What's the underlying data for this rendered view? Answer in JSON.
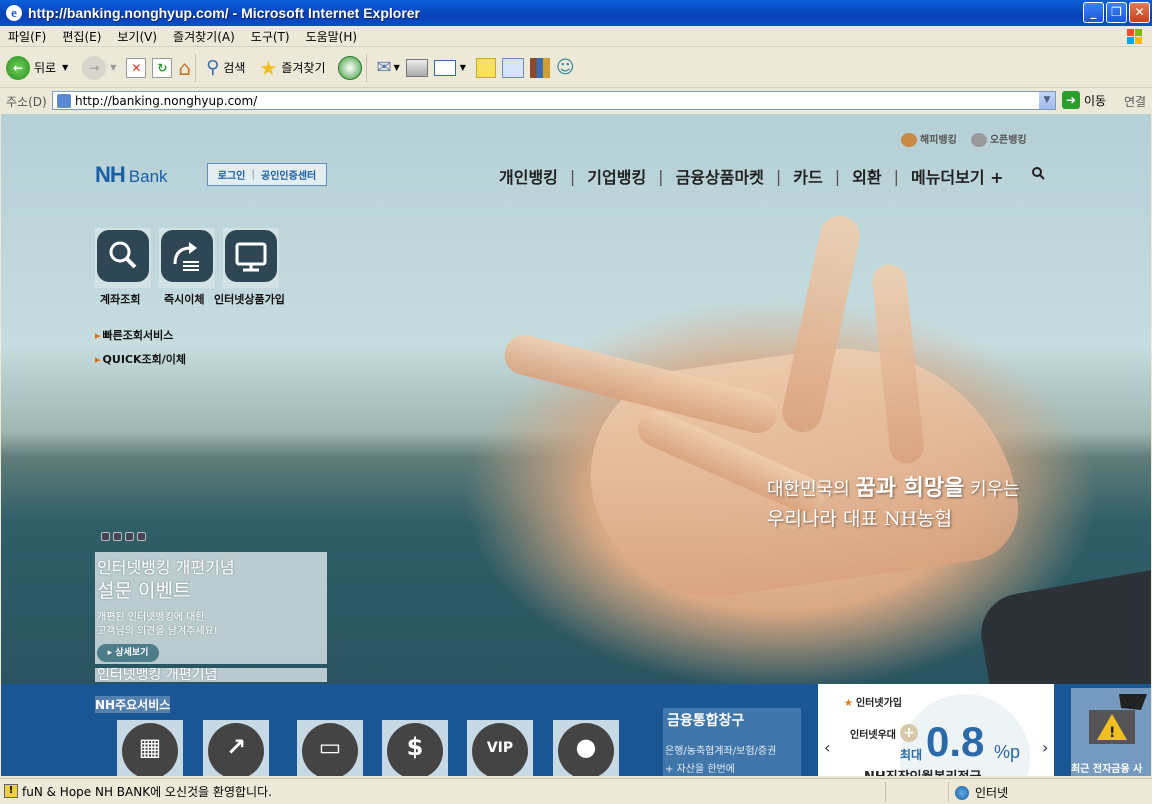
{
  "window": {
    "title": "http://banking.nonghyup.com/ - Microsoft Internet Explorer",
    "buttons": {
      "minimize": "_",
      "maximize": "❐",
      "close": "✕"
    }
  },
  "menubar": [
    "파일(F)",
    "편집(E)",
    "보기(V)",
    "즐겨찾기(A)",
    "도구(T)",
    "도움말(H)"
  ],
  "toolbar": {
    "back": "뒤로",
    "search": "검색",
    "favorites": "즐겨찾기"
  },
  "address": {
    "label": "주소(D)",
    "url": "http://banking.nonghyup.com/",
    "go": "이동",
    "links": "연결"
  },
  "page": {
    "logo": {
      "nh": "NH",
      "bank": "Bank"
    },
    "login": {
      "login": "로그인",
      "cert": "공인인증센터"
    },
    "top_links": {
      "happy": "해피뱅킹",
      "open": "오픈뱅킹"
    },
    "nav": [
      "개인뱅킹",
      "기업뱅킹",
      "금융상품마켓",
      "카드",
      "외환",
      "메뉴더보기 +"
    ],
    "quick_buttons": [
      {
        "label": "계좌조회",
        "icon": "search-icon"
      },
      {
        "label": "즉시이체",
        "icon": "transfer-icon"
      },
      {
        "label": "인터넷상품가입",
        "icon": "monitor-icon"
      }
    ],
    "quick_links": [
      "빠른조회서비스",
      "QUICK조회/이체"
    ],
    "hero": {
      "line1_a": "대한민국의 ",
      "line1_b": "꿈과 희망을",
      "line1_c": " 키우는",
      "line2": "우리나라 대표 NH농협"
    },
    "event": {
      "title1": "인터넷뱅킹 개편기념",
      "title2": "설문 이벤트",
      "desc1": "개편된 인터넷뱅킹에 대한",
      "desc2": "고객님의 의견을 남겨주세요!",
      "detail": "▸ 상세보기",
      "next_title": "인터넷뱅킹 개편기념"
    },
    "services_title": "NH주요서비스",
    "services": [
      {
        "icon": "film-icon",
        "glyph": "▦"
      },
      {
        "icon": "chart-icon",
        "glyph": "↗"
      },
      {
        "icon": "card-icon",
        "glyph": "▭"
      },
      {
        "icon": "dollar-icon",
        "glyph": "$"
      },
      {
        "icon": "vip-icon",
        "glyph": "VIP"
      },
      {
        "icon": "location-icon",
        "glyph": "●"
      }
    ],
    "finance": {
      "title": "금융통합창구",
      "desc1": "은행/농축협계좌/보험/증권",
      "desc2": "+ 자산을 한번에"
    },
    "promo": {
      "header": "인터넷가입",
      "line1": "인터넷우대",
      "plus": "+",
      "max": "최대",
      "rate": "0.8",
      "unit": "%p",
      "bottom": "NH직장인월복리적금",
      "prev": "‹",
      "next": "›"
    },
    "warning": {
      "text": "최근 전자금융 사기피해 주의"
    }
  },
  "statusbar": {
    "message": "fuN & Hope NH BANK에 오신것을 환영합니다.",
    "zone": "인터넷"
  }
}
